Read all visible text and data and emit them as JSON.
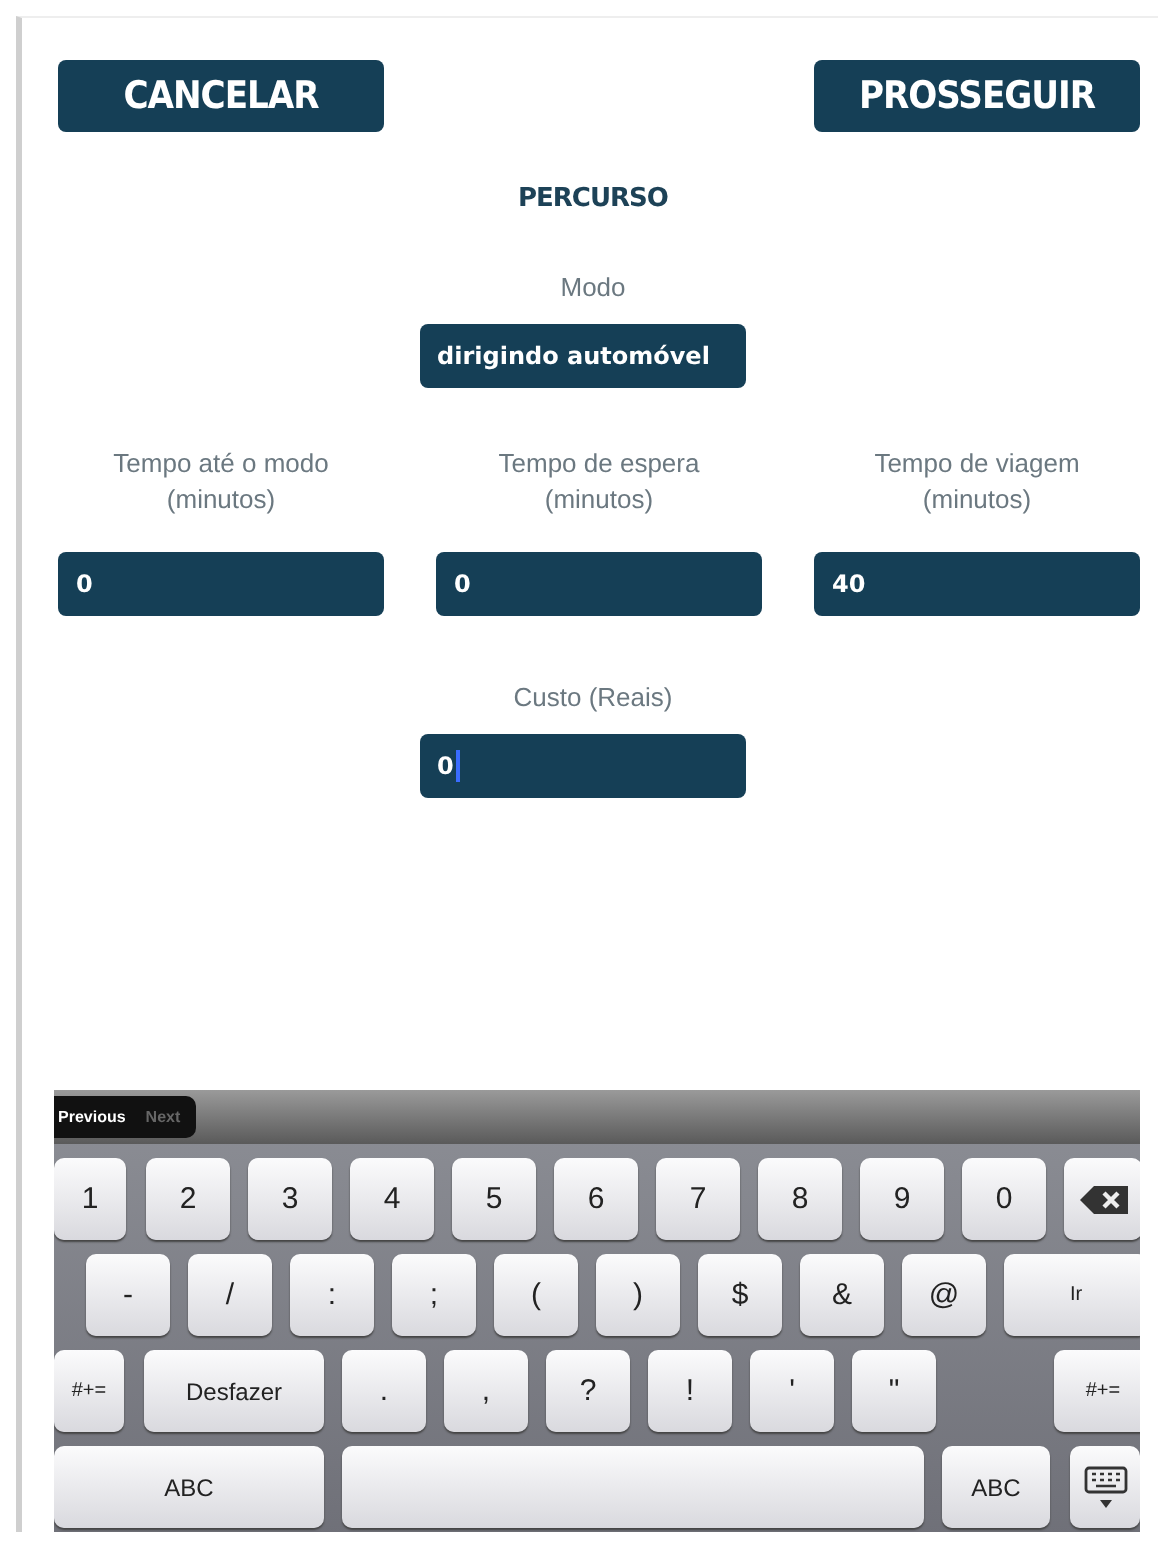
{
  "actions": [
    {
      "label": "CANCELAR"
    },
    {
      "label": "PROSSEGUIR"
    }
  ],
  "section_title": "PERCURSO",
  "mode": {
    "label": "Modo",
    "value": "dirigindo automóvel"
  },
  "time_fields": [
    {
      "label": "Tempo até o modo",
      "unit": "(minutos)",
      "value": "0",
      "focused": false
    },
    {
      "label": "Tempo de espera",
      "unit": "(minutos)",
      "value": "0",
      "focused": false
    },
    {
      "label": "Tempo de viagem",
      "unit": "(minutos)",
      "value": "40",
      "focused": false
    }
  ],
  "cost_field": {
    "label": "Custo (Reais)",
    "value": "0",
    "focused": true
  },
  "keyboard": {
    "toolbar": [
      {
        "label": "Previous",
        "disabled": false
      },
      {
        "label": "Next",
        "disabled": true
      }
    ],
    "rows": [
      [
        {
          "kind": "key",
          "label": "1"
        },
        {
          "kind": "key",
          "label": "2"
        },
        {
          "kind": "key",
          "label": "3"
        },
        {
          "kind": "key",
          "label": "4"
        },
        {
          "kind": "key",
          "label": "5"
        },
        {
          "kind": "key",
          "label": "6"
        },
        {
          "kind": "key",
          "label": "7"
        },
        {
          "kind": "key",
          "label": "8"
        },
        {
          "kind": "key",
          "label": "9"
        },
        {
          "kind": "key",
          "label": "0"
        },
        {
          "kind": "backspace"
        }
      ],
      [
        {
          "kind": "key",
          "label": "-"
        },
        {
          "kind": "key",
          "label": "/"
        },
        {
          "kind": "key",
          "label": ":"
        },
        {
          "kind": "key",
          "label": ";"
        },
        {
          "kind": "key",
          "label": "("
        },
        {
          "kind": "key",
          "label": ")"
        },
        {
          "kind": "key",
          "label": "$"
        },
        {
          "kind": "key",
          "label": "&"
        },
        {
          "kind": "key",
          "label": "@"
        },
        {
          "kind": "key",
          "label": "Ir"
        }
      ],
      [
        {
          "kind": "key",
          "label": "#+="
        },
        {
          "kind": "key",
          "label": "Desfazer"
        },
        {
          "kind": "key",
          "label": "."
        },
        {
          "kind": "key",
          "label": ","
        },
        {
          "kind": "key",
          "label": "?"
        },
        {
          "kind": "key",
          "label": "!"
        },
        {
          "kind": "key",
          "label": "'"
        },
        {
          "kind": "key",
          "label": "\""
        },
        {
          "kind": "key",
          "label": "#+="
        }
      ],
      [
        {
          "kind": "key",
          "label": "ABC"
        },
        {
          "kind": "space"
        },
        {
          "kind": "key",
          "label": "ABC"
        },
        {
          "kind": "hide"
        }
      ]
    ]
  }
}
